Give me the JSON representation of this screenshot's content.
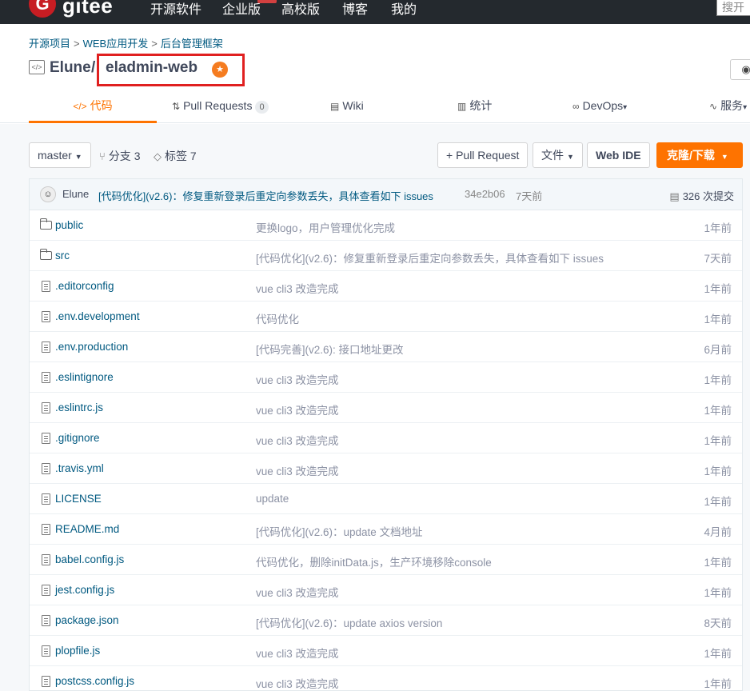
{
  "topnav": {
    "logo_mark": "G",
    "logo_text": "gitee",
    "items": [
      "开源软件",
      "企业版",
      "高校版",
      "博客",
      "我的"
    ],
    "search_placeholder": "搜开"
  },
  "breadcrumb": [
    "开源项目",
    "WEB应用开发",
    "后台管理框架"
  ],
  "repo": {
    "owner": "Elune",
    "slash": "/",
    "name": "eladmin-web",
    "watch_icon": "eye-icon"
  },
  "tabs": [
    {
      "icon": "</>",
      "label": "代码"
    },
    {
      "icon": "⇅",
      "label": "Pull Requests",
      "count": "0"
    },
    {
      "icon": "▤",
      "label": "Wiki"
    },
    {
      "icon": "▥",
      "label": "统计"
    },
    {
      "icon": "∞",
      "label": "DevOps",
      "caret": "▾"
    },
    {
      "icon": "∿",
      "label": "服务",
      "caret": "▾"
    }
  ],
  "toolbar": {
    "branch": "master",
    "branches": "分支 3",
    "tags": "标签 7",
    "pull_request": "+ Pull Request",
    "file": "文件",
    "web_ide": "Web IDE",
    "clone": "克隆/下载"
  },
  "commit": {
    "avatar": "☺",
    "author": "Elune",
    "message": "[代码优化](v2.6)：修复重新登录后重定向参数丢失，具体查看如下 issues",
    "hash": "34e2b06",
    "time": "7天前",
    "count": "326 次提交"
  },
  "files": [
    {
      "type": "folder",
      "name": "public",
      "message": "更换logo，用户管理优化完成",
      "time": "1年前"
    },
    {
      "type": "folder",
      "name": "src",
      "message": "[代码优化](v2.6)：修复重新登录后重定向参数丢失，具体查看如下 issues",
      "time": "7天前"
    },
    {
      "type": "file",
      "name": ".editorconfig",
      "message": "vue cli3 改造完成",
      "time": "1年前"
    },
    {
      "type": "file",
      "name": ".env.development",
      "message": "代码优化",
      "time": "1年前"
    },
    {
      "type": "file",
      "name": ".env.production",
      "message": "[代码完善](v2.6): 接口地址更改",
      "time": "6月前"
    },
    {
      "type": "file",
      "name": ".eslintignore",
      "message": "vue cli3 改造完成",
      "time": "1年前"
    },
    {
      "type": "file",
      "name": ".eslintrc.js",
      "message": "vue cli3 改造完成",
      "time": "1年前"
    },
    {
      "type": "file",
      "name": ".gitignore",
      "message": "vue cli3 改造完成",
      "time": "1年前"
    },
    {
      "type": "file",
      "name": ".travis.yml",
      "message": "vue cli3 改造完成",
      "time": "1年前"
    },
    {
      "type": "file",
      "name": "LICENSE",
      "message": "update",
      "time": "1年前"
    },
    {
      "type": "file",
      "name": "README.md",
      "message": "[代码优化](v2.6)：update 文档地址",
      "time": "4月前"
    },
    {
      "type": "file",
      "name": "babel.config.js",
      "message": "代码优化，删除initData.js，生产环境移除console",
      "time": "1年前"
    },
    {
      "type": "file",
      "name": "jest.config.js",
      "message": "vue cli3 改造完成",
      "time": "1年前"
    },
    {
      "type": "file",
      "name": "package.json",
      "message": "[代码优化](v2.6)：update axios version",
      "time": "8天前"
    },
    {
      "type": "file",
      "name": "plopfile.js",
      "message": "vue cli3 改造完成",
      "time": "1年前"
    },
    {
      "type": "file",
      "name": "postcss.config.js",
      "message": "vue cli3 改造完成",
      "time": "1年前"
    }
  ]
}
